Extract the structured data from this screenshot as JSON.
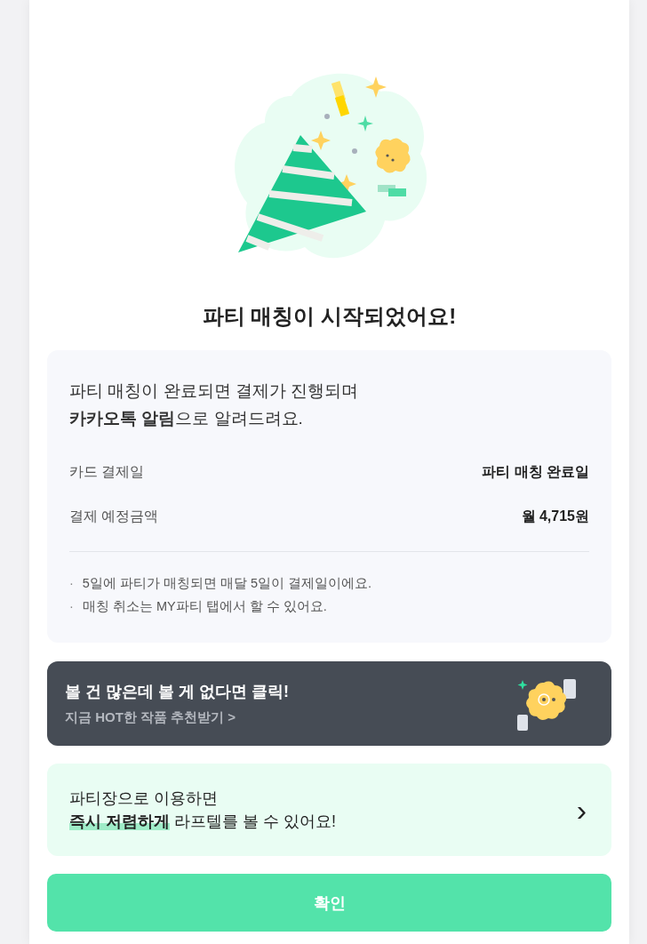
{
  "title": "파티 매칭이 시작되었어요!",
  "info": {
    "message_lines": [
      "파티 매칭이 완료되면 결제가 진행되며",
      "**카카오톡 알림**으로 알려드려요."
    ],
    "rows": [
      {
        "label": "카드 결제일",
        "value": "파티 매칭 완료일"
      },
      {
        "label": "결제 예정금액",
        "value": "월 4,715원"
      }
    ],
    "notes": [
      {
        "bullet": "·",
        "text": "5일에 파티가 매칭되면 매달 5일이 결제일이에요."
      },
      {
        "bullet": "·",
        "text": "매칭 취소는 MY파티 탭에서 할 수 있어요."
      }
    ]
  },
  "banner": {
    "title": "볼 건 많은데 볼 게 없다면 클릭!",
    "link": "지금 HOT한 작품 추천받기 >"
  },
  "promo": {
    "lines": [
      "파티장으로 이용하면",
      "**즉시 저렴하게** 라프텔를 볼 수 있어요!"
    ],
    "chevron": "›"
  },
  "confirm_button": "확인"
}
